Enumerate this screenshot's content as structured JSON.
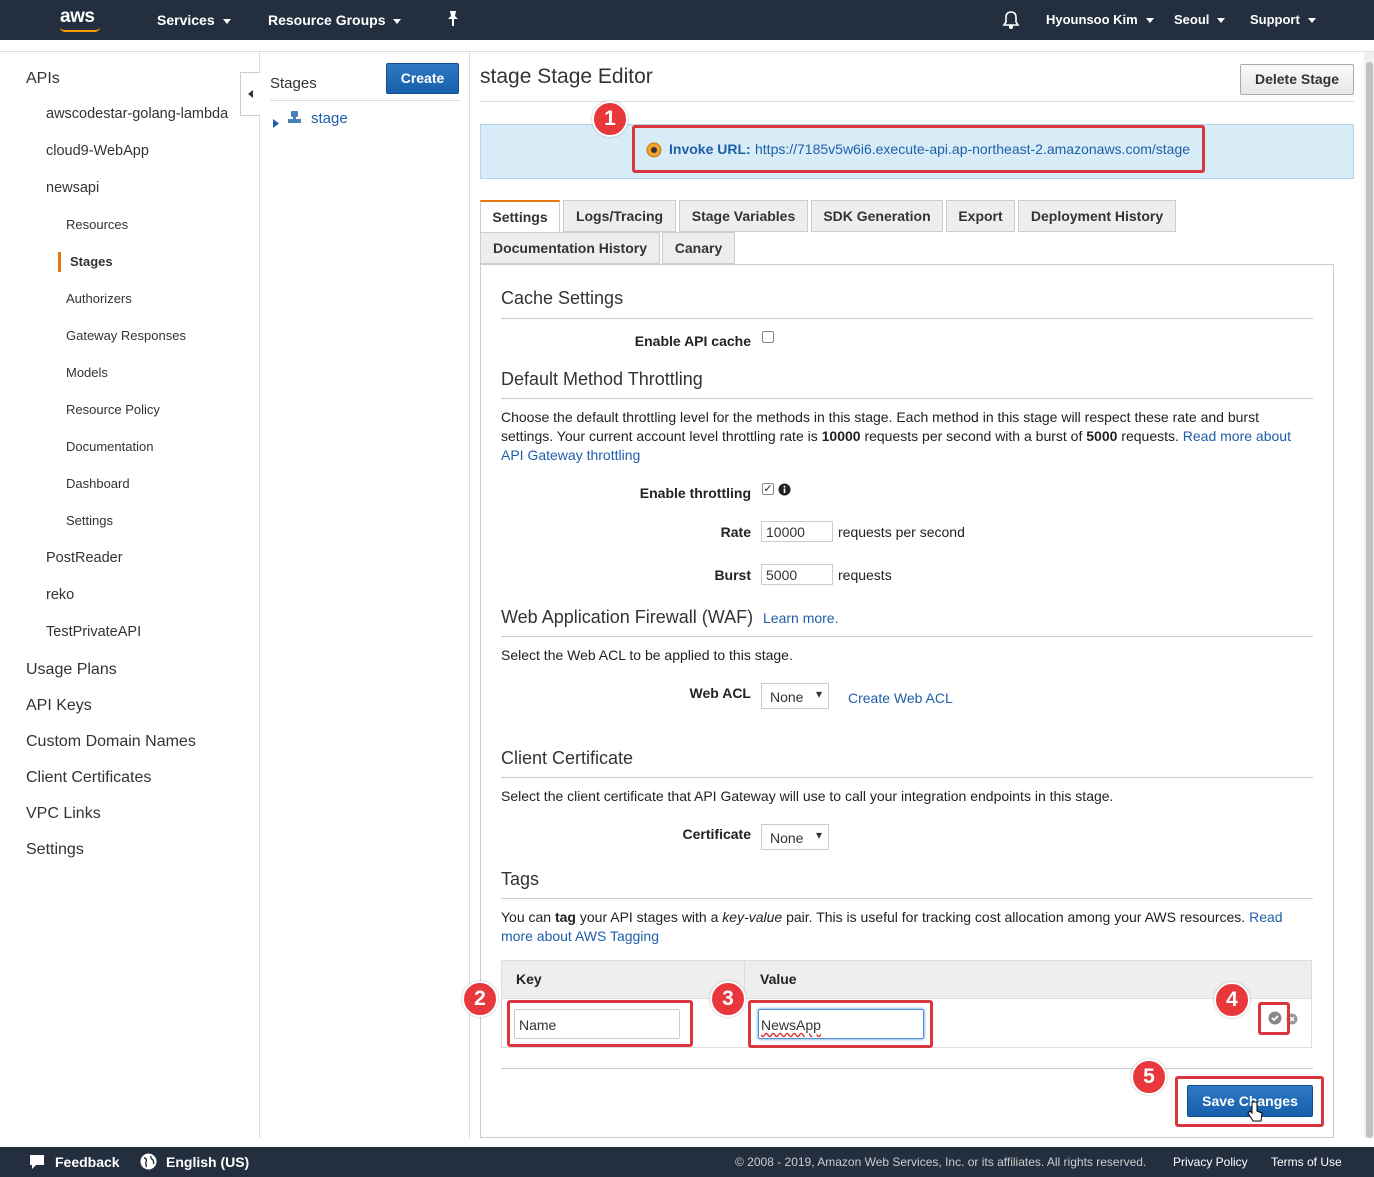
{
  "topbar": {
    "logo": "aws",
    "services": "Services",
    "resource_groups": "Resource Groups",
    "user": "Hyounsoo Kim",
    "region": "Seoul",
    "support": "Support"
  },
  "sidebar": {
    "apis": "APIs",
    "api_list": [
      "awscodestar-golang-lambda",
      "cloud9-WebApp",
      "newsapi"
    ],
    "newsapi_items": [
      "Resources",
      "Stages",
      "Authorizers",
      "Gateway Responses",
      "Models",
      "Resource Policy",
      "Documentation",
      "Dashboard",
      "Settings"
    ],
    "api_list_after": [
      "PostReader",
      "reko",
      "TestPrivateAPI"
    ],
    "top_items": [
      "Usage Plans",
      "API Keys",
      "Custom Domain Names",
      "Client Certificates",
      "VPC Links",
      "Settings"
    ]
  },
  "stages": {
    "heading": "Stages",
    "create": "Create",
    "stage_name": "stage"
  },
  "editor": {
    "title": "stage Stage Editor",
    "delete_stage": "Delete Stage",
    "invoke_label": "Invoke URL:",
    "invoke_url": "https://7185v5w6i6.execute-api.ap-northeast-2.amazonaws.com/stage",
    "tabs": [
      "Settings",
      "Logs/Tracing",
      "Stage Variables",
      "SDK Generation",
      "Export",
      "Deployment History",
      "Documentation History",
      "Canary"
    ],
    "cache": {
      "heading": "Cache Settings",
      "enable_label": "Enable API cache"
    },
    "throttling": {
      "heading": "Default Method Throttling",
      "desc1": "Choose the default throttling level for the methods in this stage. Each method in this stage will respect these rate and burst",
      "desc2a": "settings. Your current account level throttling rate is ",
      "desc2b": "10000",
      "desc2c": " requests per second with a burst of ",
      "desc2d": "5000",
      "desc2e": " requests. ",
      "desc2link": "Read more about",
      "desc3link": "API Gateway throttling",
      "enable_label": "Enable throttling",
      "rate_label": "Rate",
      "rate_value": "10000",
      "rate_unit": "requests per second",
      "burst_label": "Burst",
      "burst_value": "5000",
      "burst_unit": "requests"
    },
    "waf": {
      "heading": "Web Application Firewall (WAF)",
      "learn_more": "Learn more.",
      "desc": "Select the Web ACL to be applied to this stage.",
      "acl_label": "Web ACL",
      "acl_value": "None",
      "create_acl": "Create Web ACL"
    },
    "cert": {
      "heading": "Client Certificate",
      "desc": "Select the client certificate that API Gateway will use to call your integration endpoints in this stage.",
      "label": "Certificate",
      "value": "None"
    },
    "tags": {
      "heading": "Tags",
      "desc_a": "You can ",
      "desc_b": "tag",
      "desc_c": " your API stages with a ",
      "desc_d": "key-value",
      "desc_e": " pair. This is useful for tracking cost allocation among your AWS resources. ",
      "desc_link1": "Read",
      "desc_link2": "more about AWS Tagging",
      "col_key": "Key",
      "col_value": "Value",
      "key_value": "Name",
      "value_value": "NewsApp"
    },
    "save": "Save Changes"
  },
  "badges": [
    "1",
    "2",
    "3",
    "4",
    "5"
  ],
  "footer": {
    "feedback": "Feedback",
    "language": "English (US)",
    "copyright": "© 2008 - 2019, Amazon Web Services, Inc. or its affiliates. All rights reserved.",
    "privacy": "Privacy Policy",
    "terms": "Terms of Use"
  },
  "colors": {
    "topbar": "#232f3e",
    "accent": "#e47911",
    "primary": "#155fab",
    "annotation": "#d9363e"
  }
}
